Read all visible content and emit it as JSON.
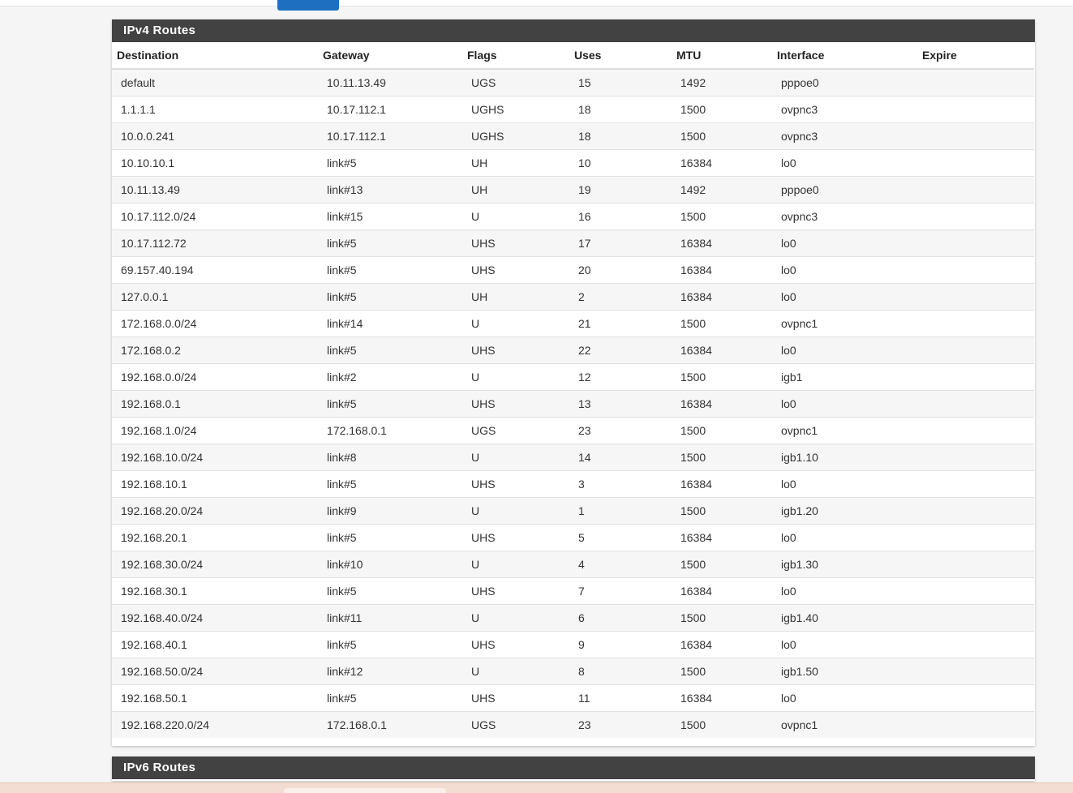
{
  "ipv4": {
    "title": "IPv4 Routes",
    "columns": [
      "Destination",
      "Gateway",
      "Flags",
      "Uses",
      "MTU",
      "Interface",
      "Expire"
    ],
    "rows": [
      [
        "default",
        "10.11.13.49",
        "UGS",
        "15",
        "1492",
        "pppoe0",
        ""
      ],
      [
        "1.1.1.1",
        "10.17.112.1",
        "UGHS",
        "18",
        "1500",
        "ovpnc3",
        ""
      ],
      [
        "10.0.0.241",
        "10.17.112.1",
        "UGHS",
        "18",
        "1500",
        "ovpnc3",
        ""
      ],
      [
        "10.10.10.1",
        "link#5",
        "UH",
        "10",
        "16384",
        "lo0",
        ""
      ],
      [
        "10.11.13.49",
        "link#13",
        "UH",
        "19",
        "1492",
        "pppoe0",
        ""
      ],
      [
        "10.17.112.0/24",
        "link#15",
        "U",
        "16",
        "1500",
        "ovpnc3",
        ""
      ],
      [
        "10.17.112.72",
        "link#5",
        "UHS",
        "17",
        "16384",
        "lo0",
        ""
      ],
      [
        "69.157.40.194",
        "link#5",
        "UHS",
        "20",
        "16384",
        "lo0",
        ""
      ],
      [
        "127.0.0.1",
        "link#5",
        "UH",
        "2",
        "16384",
        "lo0",
        ""
      ],
      [
        "172.168.0.0/24",
        "link#14",
        "U",
        "21",
        "1500",
        "ovpnc1",
        ""
      ],
      [
        "172.168.0.2",
        "link#5",
        "UHS",
        "22",
        "16384",
        "lo0",
        ""
      ],
      [
        "192.168.0.0/24",
        "link#2",
        "U",
        "12",
        "1500",
        "igb1",
        ""
      ],
      [
        "192.168.0.1",
        "link#5",
        "UHS",
        "13",
        "16384",
        "lo0",
        ""
      ],
      [
        "192.168.1.0/24",
        "172.168.0.1",
        "UGS",
        "23",
        "1500",
        "ovpnc1",
        ""
      ],
      [
        "192.168.10.0/24",
        "link#8",
        "U",
        "14",
        "1500",
        "igb1.10",
        ""
      ],
      [
        "192.168.10.1",
        "link#5",
        "UHS",
        "3",
        "16384",
        "lo0",
        ""
      ],
      [
        "192.168.20.0/24",
        "link#9",
        "U",
        "1",
        "1500",
        "igb1.20",
        ""
      ],
      [
        "192.168.20.1",
        "link#5",
        "UHS",
        "5",
        "16384",
        "lo0",
        ""
      ],
      [
        "192.168.30.0/24",
        "link#10",
        "U",
        "4",
        "1500",
        "igb1.30",
        ""
      ],
      [
        "192.168.30.1",
        "link#5",
        "UHS",
        "7",
        "16384",
        "lo0",
        ""
      ],
      [
        "192.168.40.0/24",
        "link#11",
        "U",
        "6",
        "1500",
        "igb1.40",
        ""
      ],
      [
        "192.168.40.1",
        "link#5",
        "UHS",
        "9",
        "16384",
        "lo0",
        ""
      ],
      [
        "192.168.50.0/24",
        "link#12",
        "U",
        "8",
        "1500",
        "igb1.50",
        ""
      ],
      [
        "192.168.50.1",
        "link#5",
        "UHS",
        "11",
        "16384",
        "lo0",
        ""
      ],
      [
        "192.168.220.0/24",
        "172.168.0.1",
        "UGS",
        "23",
        "1500",
        "ovpnc1",
        ""
      ]
    ]
  },
  "ipv6": {
    "title": "IPv6 Routes"
  },
  "colors": {
    "panel_heading_bg": "#424242",
    "active_tab_accent": "#1e6fc0"
  }
}
